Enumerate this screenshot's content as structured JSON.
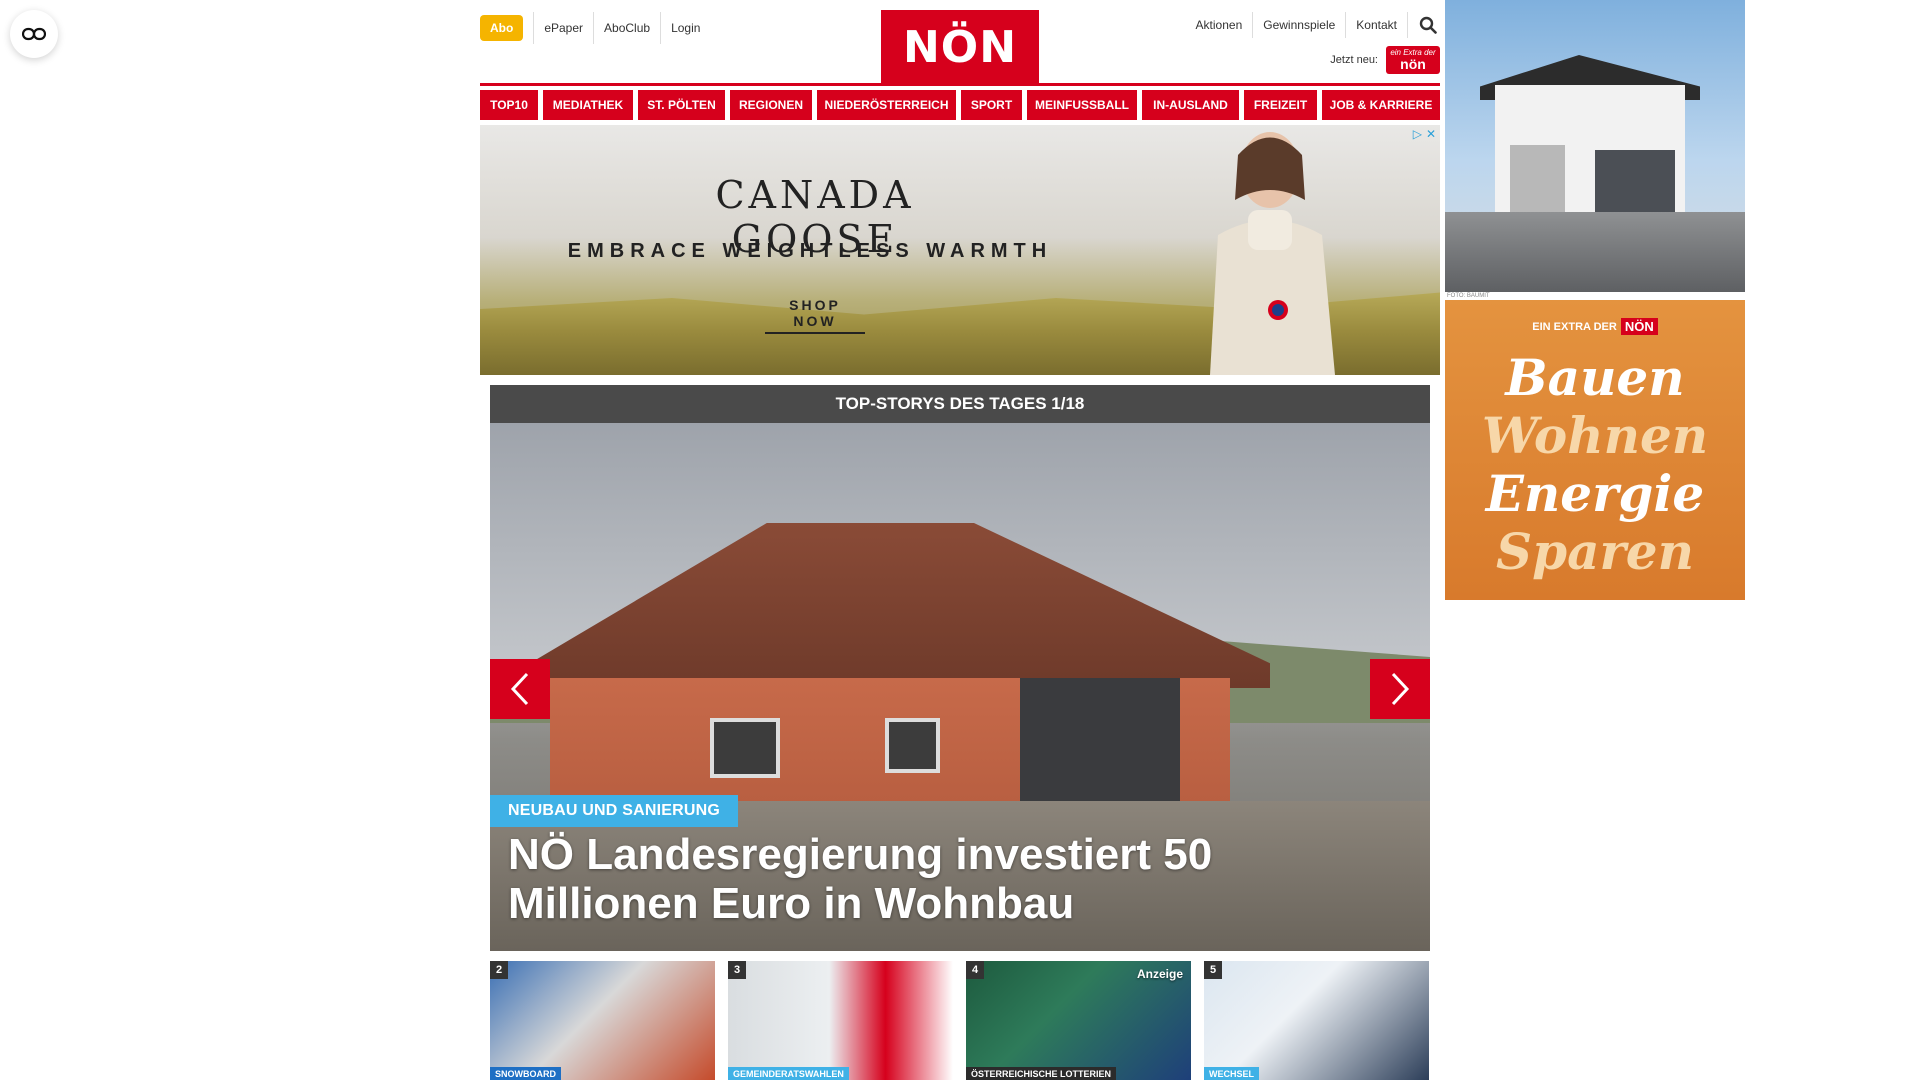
{
  "header": {
    "abo_label": "Abo",
    "left_links": [
      "ePaper",
      "AboClub",
      "Login"
    ],
    "logo_text": "NÖN",
    "right_links": [
      "Aktionen",
      "Gewinnspiele",
      "Kontakt"
    ],
    "jetzt_label": "Jetzt neu:",
    "jetzt_logo_small": "ein Extra der",
    "jetzt_logo_big": "nön"
  },
  "categories": [
    "TOP10",
    "MEDIATHEK",
    "ST. PÖLTEN",
    "REGIONEN",
    "NIEDERÖSTERREICH",
    "SPORT",
    "MEINFUSSBALL",
    "IN-AUSLAND",
    "FREIZEIT",
    "JOB & KARRIERE"
  ],
  "ad_banner": {
    "brand": "CANADA GOOSE",
    "tagline": "EMBRACE WEIGHTLESS WARMTH",
    "cta": "SHOP NOW"
  },
  "top_stories": {
    "bar_title": "TOP-STORYS DES TAGES 1/18",
    "hero": {
      "tag": "NEUBAU UND SANIERUNG",
      "title": "NÖ Landesregierung investiert 50 Millionen Euro in Wohnbau"
    },
    "thumbs": [
      {
        "num": "2",
        "category": "SNOWBOARD",
        "anzeige": "",
        "tag_color": "#1e6fc4"
      },
      {
        "num": "3",
        "category": "GEMEINDERATSWAHLEN",
        "anzeige": "",
        "tag_color": "#3fb1e6"
      },
      {
        "num": "4",
        "category": "ÖSTERREICHISCHE LOTTERIEN",
        "anzeige": "Anzeige",
        "tag_color": "#2b2b2b"
      },
      {
        "num": "5",
        "category": "WECHSEL",
        "anzeige": "",
        "tag_color": "#3fb1e6"
      }
    ]
  },
  "sidebar": {
    "foto_credit": "FOTO: BAUMIT",
    "bauen_ad": {
      "extra_label": "EIN EXTRA DER",
      "extra_logo": "NÖN",
      "words": [
        "Bauen",
        "Wohnen",
        "Energie",
        "Sparen"
      ]
    }
  },
  "colors": {
    "brand_red": "#d6001c",
    "abo_yellow": "#f5b400",
    "tag_blue": "#3fb1e6",
    "bar_gray": "#4a4a4a"
  }
}
